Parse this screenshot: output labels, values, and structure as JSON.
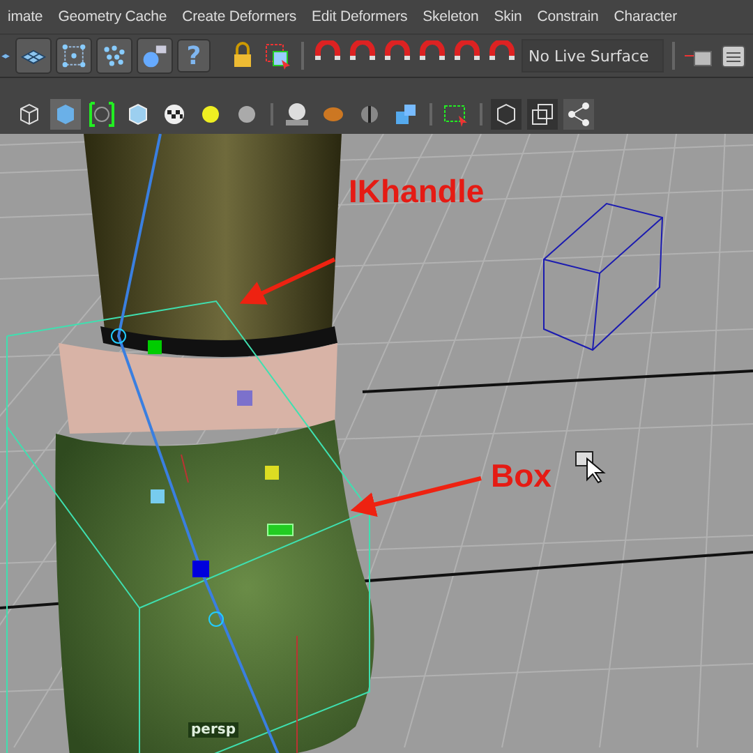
{
  "menu_bar": {
    "items": [
      "imate",
      "Geometry Cache",
      "Create Deformers",
      "Edit Deformers",
      "Skeleton",
      "Skin",
      "Constrain",
      "Character"
    ]
  },
  "status_line": {
    "help_button": "?",
    "live_surface": "No Live Surface"
  },
  "viewport": {
    "annotations": [
      {
        "text": "IKhandle",
        "kind": "ik"
      },
      {
        "text": "Box",
        "kind": "box"
      }
    ],
    "camera_label": "persp"
  }
}
